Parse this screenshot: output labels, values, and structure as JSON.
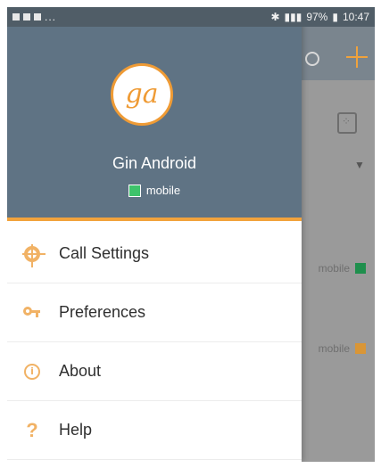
{
  "status_bar": {
    "left_icons": [
      "notification-icon",
      "message-icon",
      "image-icon"
    ],
    "left_more": "...",
    "battery": "97%",
    "time": "10:47"
  },
  "background_list": {
    "row1_status": "mobile",
    "row2_status": "mobile",
    "row1_color": "#1f8f4d",
    "row2_color": "#d99637"
  },
  "drawer": {
    "account": {
      "initials": "ga",
      "name": "Gin Android",
      "status": "mobile",
      "status_color": "#3ec36b"
    },
    "menu": [
      {
        "icon": "gear-icon",
        "label": "Call Settings"
      },
      {
        "icon": "key-icon",
        "label": "Preferences"
      },
      {
        "icon": "info-icon",
        "label": "About"
      },
      {
        "icon": "help-icon",
        "label": "Help"
      }
    ]
  }
}
